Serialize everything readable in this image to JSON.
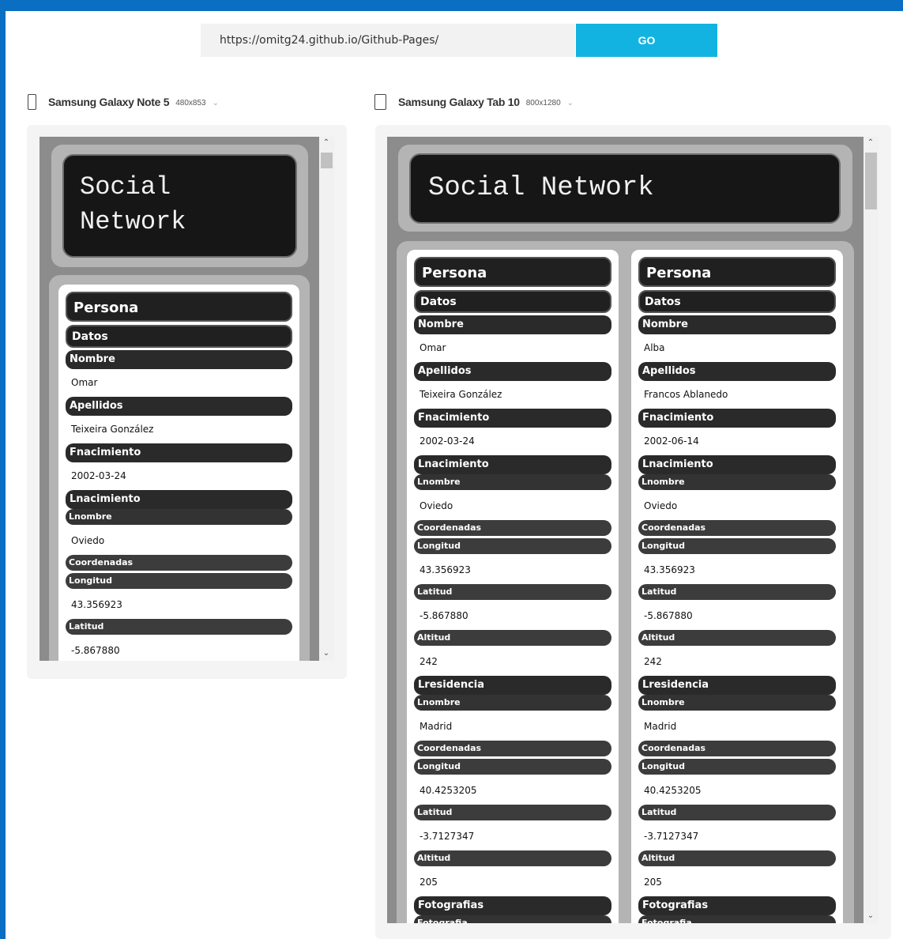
{
  "toolbar": {
    "url": "https://omitg24.github.io/Github-Pages/",
    "go_label": "GO"
  },
  "devices": [
    {
      "name": "Samsung Galaxy Note 5",
      "size": "480x853"
    },
    {
      "name": "Samsung Galaxy Tab 10",
      "size": "800x1280"
    }
  ],
  "site": {
    "title_phone": "Social\nNetwork",
    "title_tablet": "Social Network",
    "persons": [
      {
        "persona_label": "Persona",
        "datos_label": "Datos",
        "nombre_label": "Nombre",
        "nombre": "Omar",
        "apellidos_label": "Apellidos",
        "apellidos": "Teixeira González",
        "fnacimiento_label": "Fnacimiento",
        "fnacimiento": "2002-03-24",
        "lnacimiento_label": "Lnacimiento",
        "lnombre_label": "Lnombre",
        "lnacimiento_nombre": "Oviedo",
        "coordenadas_label": "Coordenadas",
        "longitud_label": "Longitud",
        "lnacimiento_longitud": "43.356923",
        "latitud_label": "Latitud",
        "lnacimiento_latitud": "-5.867880",
        "altitud_label": "Altitud",
        "lnacimiento_altitud": "242",
        "lresidencia_label": "Lresidencia",
        "lresidencia_nombre": "Madrid",
        "lresidencia_longitud": "40.4253205",
        "lresidencia_latitud": "-3.7127347",
        "lresidencia_altitud": "205",
        "fotografias_label": "Fotografias",
        "fotografia_label": "Fotografia"
      },
      {
        "persona_label": "Persona",
        "datos_label": "Datos",
        "nombre_label": "Nombre",
        "nombre": "Alba",
        "apellidos_label": "Apellidos",
        "apellidos": "Francos Ablanedo",
        "fnacimiento_label": "Fnacimiento",
        "fnacimiento": "2002-06-14",
        "lnacimiento_label": "Lnacimiento",
        "lnombre_label": "Lnombre",
        "lnacimiento_nombre": "Oviedo",
        "coordenadas_label": "Coordenadas",
        "longitud_label": "Longitud",
        "lnacimiento_longitud": "43.356923",
        "latitud_label": "Latitud",
        "lnacimiento_latitud": "-5.867880",
        "altitud_label": "Altitud",
        "lnacimiento_altitud": "242",
        "lresidencia_label": "Lresidencia",
        "lresidencia_nombre": "Madrid",
        "lresidencia_longitud": "40.4253205",
        "lresidencia_latitud": "-3.7127347",
        "lresidencia_altitud": "205",
        "fotografias_label": "Fotografias",
        "fotografia_label": "Fotografia"
      }
    ]
  },
  "icons": {
    "phone": "phone-icon",
    "tablet": "tablet-icon",
    "chevron": "chevron-down-icon",
    "scroll_up": "scroll-up-icon",
    "scroll_down": "scroll-down-icon"
  },
  "colors": {
    "frame": "#0a6fc2",
    "go_button": "#12b3e0",
    "site_header": "#161616",
    "site_bar": "#202020"
  }
}
